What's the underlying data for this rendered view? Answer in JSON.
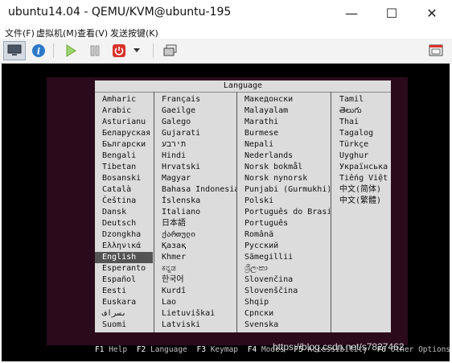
{
  "window": {
    "title": "ubuntu14.04 - QEMU/KVM@ubuntu-195",
    "minimize_glyph": "—",
    "maximize_glyph": "☐",
    "close_glyph": "✕"
  },
  "menu": [
    "文件(F)",
    "虚拟机(M)",
    "查看(V)",
    "发送按键(K)"
  ],
  "toolbar": {
    "icons": [
      "monitor-icon",
      "info-icon",
      "play-icon",
      "pause-icon",
      "power-icon",
      "dropdown-icon",
      "snapshot-icon",
      "fullscreen-icon"
    ]
  },
  "installer": {
    "header": "Language",
    "columns": [
      [
        "Amharic",
        "Arabic",
        "Asturianu",
        "Беларуская",
        "Български",
        "Bengali",
        "Tibetan",
        "Bosanski",
        "Català",
        "Čeština",
        "Dansk",
        "Deutsch",
        "Dzongkha",
        "Ελληνικά",
        "English",
        "Esperanto",
        "Español",
        "Eesti",
        "Euskara",
        "ىسراف",
        "Suomi"
      ],
      [
        "Français",
        "Gaeilge",
        "Galego",
        "Gujarati",
        "תירבע",
        "Hindi",
        "Hrvatski",
        "Magyar",
        "Bahasa Indonesia",
        "Íslenska",
        "Italiano",
        "日本語",
        "ქართული",
        "Қазақ",
        "Khmer",
        "ಕನ್ನಡ",
        "한국어",
        "Kurdî",
        "Lao",
        "Lietuviškai",
        "Latviski"
      ],
      [
        "Македонски",
        "Malayalam",
        "Marathi",
        "Burmese",
        "Nepali",
        "Nederlands",
        "Norsk bokmål",
        "Norsk nynorsk",
        "Punjabi (Gurmukhi)",
        "Polski",
        "Português do Brasil",
        "Português",
        "Română",
        "Русский",
        "Sãmegillii",
        "ශ්‍රීලංකා",
        "Slovenčina",
        "Slovenščina",
        "Shqip",
        "Српски",
        "Svenska"
      ],
      [
        "Tamil",
        "తెలుగు",
        "Thai",
        "Tagalog",
        "Türkçe",
        "Uyghur",
        "Українська",
        "Tiếng Việt",
        "中文(简体)",
        "中文(繁體)"
      ]
    ],
    "selected": "English",
    "function_keys": [
      {
        "key": "F1",
        "label": "Help"
      },
      {
        "key": "F2",
        "label": "Language"
      },
      {
        "key": "F3",
        "label": "Keymap"
      },
      {
        "key": "F4",
        "label": "Modes"
      },
      {
        "key": "F5",
        "label": "Accessibility"
      },
      {
        "key": "F6",
        "label": "Other Options"
      }
    ]
  },
  "watermark": "https://blog.csdn.net/s7827462",
  "colors": {
    "console_bg": "#2b0a1c",
    "panel_bg": "#dcdcdc",
    "selection": "#545454",
    "toolbar_play": "#7fc04a",
    "toolbar_power": "#d9332b",
    "toolbar_info": "#2b79c8"
  }
}
